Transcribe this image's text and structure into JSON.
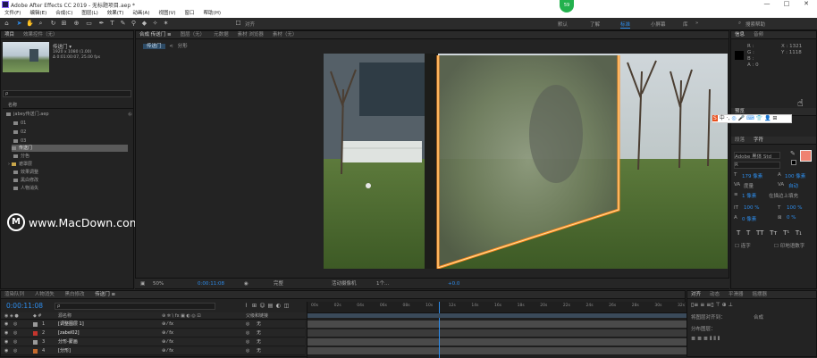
{
  "titlebar": {
    "title": "Adobe After Effects CC 2019 - 无标题项目.aep *",
    "minimize": "—",
    "maximize": "□",
    "close": "✕"
  },
  "menubar": {
    "items": [
      "文件(F)",
      "编辑(E)",
      "合成(C)",
      "图层(L)",
      "效果(T)",
      "动画(A)",
      "视图(V)",
      "窗口",
      "帮助(H)"
    ]
  },
  "toolbar": {
    "snap_label": "对齐",
    "workspaces": [
      "默认",
      "了解",
      "标准",
      "小屏幕",
      "库"
    ],
    "active_workspace": "标准",
    "search_placeholder": "搜索帮助",
    "badge": "59"
  },
  "project_panel": {
    "tabs": [
      "项目",
      "效果控件（无）"
    ],
    "comp_name": "传送门 ▾",
    "comp_info_1": "1920 x 1080 (1.00)",
    "comp_info_2": "Δ 0:01:00:07, 25.00 fps",
    "search_placeholder": "ρ",
    "column_name": "名称",
    "items": [
      "jabey传送门.aep",
      "01",
      "02",
      "03",
      "传送门",
      "分色",
      "遮罩层",
      "效果调整",
      "黑白修改",
      "人物消失"
    ],
    "selected_item": "传送门"
  },
  "comp_panel": {
    "tabs": [
      "合成 传送门 ≡",
      "图层（无）",
      "元数据",
      "素材 浏览器",
      "素材（无）"
    ],
    "subtabs": [
      "传送门",
      "分形"
    ],
    "zoom": "50%",
    "timecode": "0:00:11:08",
    "resolution": "完整",
    "camera": "活动摄像机",
    "views": "1个...",
    "exposure": "+0.0"
  },
  "watermark": {
    "logo": "M",
    "text": "www.MacDown.com"
  },
  "right_panels": {
    "info_tabs": [
      "信息",
      "音频"
    ],
    "info_values": [
      "R :",
      "G :",
      "B :",
      "A : 0",
      "X : 1321",
      "Y : 1118"
    ],
    "preview_label": "预览",
    "character_tabs": [
      "段落",
      "字符"
    ],
    "font_name": "Adobe 黑体 Std",
    "font_style": "R",
    "font_size": "179 像素",
    "leading": "100 像素",
    "tracking": "自动",
    "kerning": "度量",
    "stroke": "1 像素",
    "stroke_type": "在描边上填充",
    "scale_v": "100 %",
    "scale_h": "100 %",
    "baseline": "0 像素",
    "tsume": "0 %",
    "styles": [
      "T",
      "T",
      "TT",
      "Tт",
      "T¹",
      "T₁"
    ],
    "ligature": "连字",
    "hindi": "印地语数字",
    "ime": [
      "S",
      "中",
      "·,",
      "◎",
      "🎤",
      "⌨",
      "👕",
      "👤",
      "⊞"
    ],
    "fill_color": "#ef8370",
    "accent_color": "#2d8ceb"
  },
  "timeline": {
    "tabs": [
      "渲染队列",
      "人物消失",
      "黑白修改",
      "传送门 ≡"
    ],
    "timecode": "0:00:11:08",
    "search_placeholder": "ρ",
    "columns": {
      "source": "源名称",
      "parent": "父级和链接"
    },
    "layers": [
      {
        "num": "1",
        "name": "[调整图层 1]",
        "color": "#9a9a9a",
        "parent": "无"
      },
      {
        "num": "2",
        "name": "[zabel02]",
        "color": "#c4352d",
        "parent": "无"
      },
      {
        "num": "3",
        "name": "分形-蒙画",
        "color": "#9a9a9a",
        "parent": "无"
      },
      {
        "num": "4",
        "name": "[分形]",
        "color": "#c46a2d",
        "parent": "无"
      }
    ],
    "ruler": [
      "00s",
      "02s",
      "04s",
      "06s",
      "08s",
      "10s",
      "12s",
      "14s",
      "16s",
      "18s",
      "20s",
      "22s",
      "24s",
      "26s",
      "28s",
      "30s",
      "32s"
    ],
    "playhead_fraction": 0.345
  },
  "align_panel": {
    "tabs": [
      "对齐",
      "动态",
      "平滑器",
      "摇摆器"
    ],
    "align_to_label": "将图层对齐到：",
    "align_to_value": "合成",
    "distribute_label": "分布图层："
  }
}
